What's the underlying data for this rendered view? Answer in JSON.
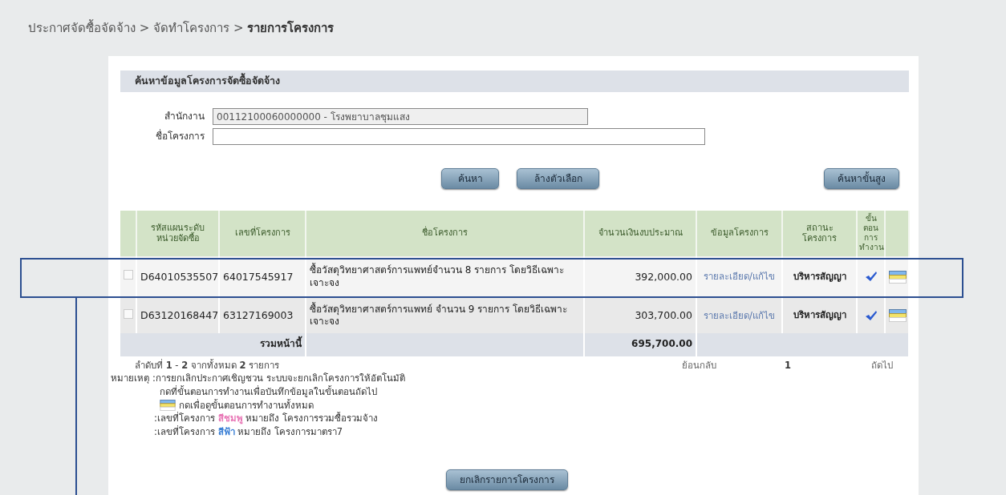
{
  "breadcrumb": {
    "items": [
      "ประกาศจัดซื้อจัดจ้าง",
      "จัดทำโครงการ"
    ],
    "separators": [
      ">",
      ">"
    ],
    "current": "รายการโครงการ"
  },
  "search_panel": {
    "title": "ค้นหาข้อมูลโครงการจัดซื้อจัดจ้าง",
    "fields": [
      {
        "label": "สำนักงาน",
        "value": "00112100060000000 - โรงพยาบาลชุมแสง",
        "disabled": true
      },
      {
        "label": "ชื่อโครงการ",
        "disabled": false
      }
    ],
    "buttons": [
      "ค้นหา",
      "ล้างตัวเลือก"
    ],
    "advanced_button": "ค้นหาขั้นสูง"
  },
  "table": {
    "columns": [
      "รหัสแผนระดับหน่วยจัดซื้อ",
      "เลขที่โครงการ",
      "ชื่อโครงการ",
      "จำนวนเงินงบประมาณ",
      "ข้อมูลโครงการ",
      "สถานะโครงการ",
      "ขั้นตอนการทำงาน"
    ],
    "rows": [
      {
        "checked": false,
        "plan_code": "D64010535507",
        "project_no": "64017545917",
        "name": "ซื้อวัสดุวิทยาศาสตร์การแพทย์จำนวน 8 รายการ โดยวิธีเฉพาะเจาะจง",
        "budget": "392,000.00",
        "link": "รายละเอียด/แก้ไข",
        "status": "บริหารสัญญา"
      },
      {
        "checked": false,
        "plan_code": "D63120168447",
        "project_no": "63127169003",
        "name": "ซื้อวัสดุวิทยาศาสตร์การแพทย์ จำนวน 9 รายการ โดยวิธีเฉพาะเจาะจง",
        "budget": "303,700.00",
        "link": "รายละเอียด/แก้ไข",
        "status": "บริหารสัญญา"
      }
    ],
    "total_label": "รวมหน้านี้",
    "total": "695,700.00"
  },
  "summary": "ลำดับที่ **1** - **2** จากทั้งหมด **2** รายการ",
  "pagination": {
    "previous": "ย้อนกลับ",
    "pages": [
      {
        "label": "1",
        "selected": true
      }
    ],
    "next": "ถัดไป"
  },
  "notes": {
    "label": "หมายเหตุ",
    "lines": [
      {
        "kind": "text",
        "text": ":การยกเลิกประกาศเชิญชวน ระบบจะยกเลิกโครงการให้อัตโนมัติ"
      },
      {
        "kind": "indent",
        "text": "กดที่ขั้นตอนการทำงานเพื่อบันทึกข้อมูลในขั้นตอนถัดไป"
      },
      {
        "kind": "icon",
        "text": "กดเพื่อดูขั้นตอนการทำงานทั้งหมด"
      },
      {
        "kind": "color",
        "prefix": ":เลขที่โครงการ",
        "highlight": "สีชมพู",
        "color": "#e875b5",
        "suffix": "หมายถึง โครงการรวมซื้อรวมจ้าง"
      },
      {
        "kind": "color",
        "prefix": ":เลขที่โครงการ",
        "highlight": "สีฟ้า",
        "color": "#3a7fd5",
        "suffix": "หมายถึง โครงการมาตรา7"
      }
    ]
  },
  "cancel_button": "ยกเลิกรายการโครงการ"
}
